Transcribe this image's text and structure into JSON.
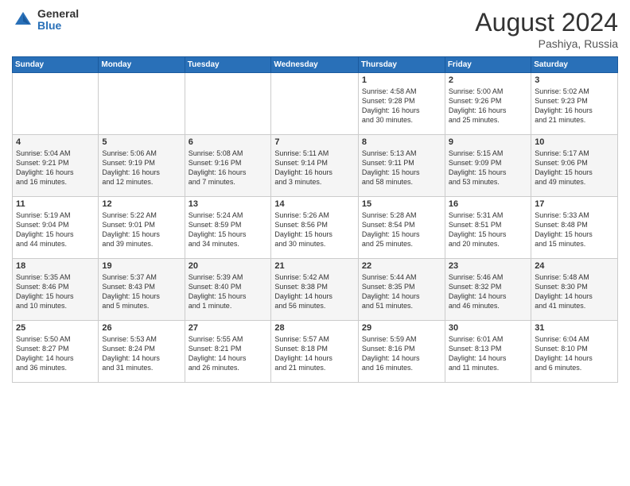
{
  "header": {
    "logo_general": "General",
    "logo_blue": "Blue",
    "month_title": "August 2024",
    "location": "Pashiya, Russia"
  },
  "days_of_week": [
    "Sunday",
    "Monday",
    "Tuesday",
    "Wednesday",
    "Thursday",
    "Friday",
    "Saturday"
  ],
  "weeks": [
    [
      {
        "day": "",
        "info": ""
      },
      {
        "day": "",
        "info": ""
      },
      {
        "day": "",
        "info": ""
      },
      {
        "day": "",
        "info": ""
      },
      {
        "day": "1",
        "info": "Sunrise: 4:58 AM\nSunset: 9:28 PM\nDaylight: 16 hours\nand 30 minutes."
      },
      {
        "day": "2",
        "info": "Sunrise: 5:00 AM\nSunset: 9:26 PM\nDaylight: 16 hours\nand 25 minutes."
      },
      {
        "day": "3",
        "info": "Sunrise: 5:02 AM\nSunset: 9:23 PM\nDaylight: 16 hours\nand 21 minutes."
      }
    ],
    [
      {
        "day": "4",
        "info": "Sunrise: 5:04 AM\nSunset: 9:21 PM\nDaylight: 16 hours\nand 16 minutes."
      },
      {
        "day": "5",
        "info": "Sunrise: 5:06 AM\nSunset: 9:19 PM\nDaylight: 16 hours\nand 12 minutes."
      },
      {
        "day": "6",
        "info": "Sunrise: 5:08 AM\nSunset: 9:16 PM\nDaylight: 16 hours\nand 7 minutes."
      },
      {
        "day": "7",
        "info": "Sunrise: 5:11 AM\nSunset: 9:14 PM\nDaylight: 16 hours\nand 3 minutes."
      },
      {
        "day": "8",
        "info": "Sunrise: 5:13 AM\nSunset: 9:11 PM\nDaylight: 15 hours\nand 58 minutes."
      },
      {
        "day": "9",
        "info": "Sunrise: 5:15 AM\nSunset: 9:09 PM\nDaylight: 15 hours\nand 53 minutes."
      },
      {
        "day": "10",
        "info": "Sunrise: 5:17 AM\nSunset: 9:06 PM\nDaylight: 15 hours\nand 49 minutes."
      }
    ],
    [
      {
        "day": "11",
        "info": "Sunrise: 5:19 AM\nSunset: 9:04 PM\nDaylight: 15 hours\nand 44 minutes."
      },
      {
        "day": "12",
        "info": "Sunrise: 5:22 AM\nSunset: 9:01 PM\nDaylight: 15 hours\nand 39 minutes."
      },
      {
        "day": "13",
        "info": "Sunrise: 5:24 AM\nSunset: 8:59 PM\nDaylight: 15 hours\nand 34 minutes."
      },
      {
        "day": "14",
        "info": "Sunrise: 5:26 AM\nSunset: 8:56 PM\nDaylight: 15 hours\nand 30 minutes."
      },
      {
        "day": "15",
        "info": "Sunrise: 5:28 AM\nSunset: 8:54 PM\nDaylight: 15 hours\nand 25 minutes."
      },
      {
        "day": "16",
        "info": "Sunrise: 5:31 AM\nSunset: 8:51 PM\nDaylight: 15 hours\nand 20 minutes."
      },
      {
        "day": "17",
        "info": "Sunrise: 5:33 AM\nSunset: 8:48 PM\nDaylight: 15 hours\nand 15 minutes."
      }
    ],
    [
      {
        "day": "18",
        "info": "Sunrise: 5:35 AM\nSunset: 8:46 PM\nDaylight: 15 hours\nand 10 minutes."
      },
      {
        "day": "19",
        "info": "Sunrise: 5:37 AM\nSunset: 8:43 PM\nDaylight: 15 hours\nand 5 minutes."
      },
      {
        "day": "20",
        "info": "Sunrise: 5:39 AM\nSunset: 8:40 PM\nDaylight: 15 hours\nand 1 minute."
      },
      {
        "day": "21",
        "info": "Sunrise: 5:42 AM\nSunset: 8:38 PM\nDaylight: 14 hours\nand 56 minutes."
      },
      {
        "day": "22",
        "info": "Sunrise: 5:44 AM\nSunset: 8:35 PM\nDaylight: 14 hours\nand 51 minutes."
      },
      {
        "day": "23",
        "info": "Sunrise: 5:46 AM\nSunset: 8:32 PM\nDaylight: 14 hours\nand 46 minutes."
      },
      {
        "day": "24",
        "info": "Sunrise: 5:48 AM\nSunset: 8:30 PM\nDaylight: 14 hours\nand 41 minutes."
      }
    ],
    [
      {
        "day": "25",
        "info": "Sunrise: 5:50 AM\nSunset: 8:27 PM\nDaylight: 14 hours\nand 36 minutes."
      },
      {
        "day": "26",
        "info": "Sunrise: 5:53 AM\nSunset: 8:24 PM\nDaylight: 14 hours\nand 31 minutes."
      },
      {
        "day": "27",
        "info": "Sunrise: 5:55 AM\nSunset: 8:21 PM\nDaylight: 14 hours\nand 26 minutes."
      },
      {
        "day": "28",
        "info": "Sunrise: 5:57 AM\nSunset: 8:18 PM\nDaylight: 14 hours\nand 21 minutes."
      },
      {
        "day": "29",
        "info": "Sunrise: 5:59 AM\nSunset: 8:16 PM\nDaylight: 14 hours\nand 16 minutes."
      },
      {
        "day": "30",
        "info": "Sunrise: 6:01 AM\nSunset: 8:13 PM\nDaylight: 14 hours\nand 11 minutes."
      },
      {
        "day": "31",
        "info": "Sunrise: 6:04 AM\nSunset: 8:10 PM\nDaylight: 14 hours\nand 6 minutes."
      }
    ]
  ]
}
